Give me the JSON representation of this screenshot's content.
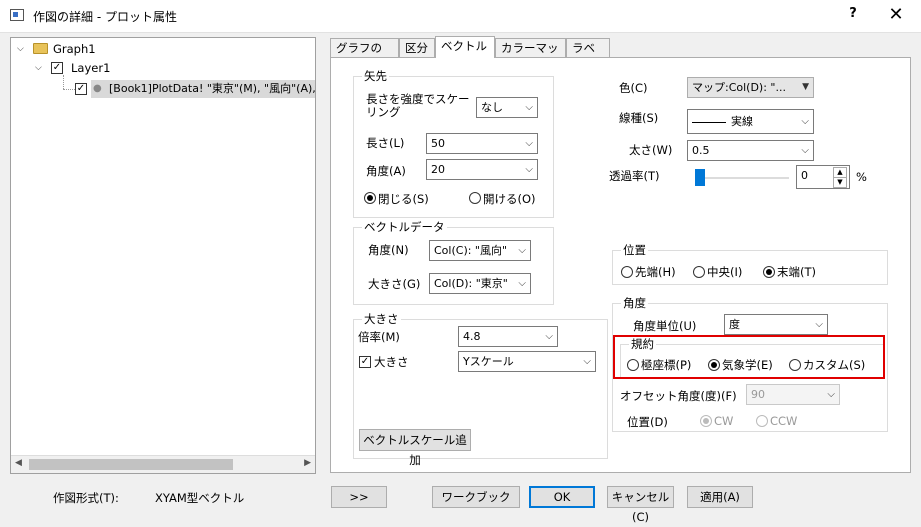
{
  "window": {
    "title": "作図の詳細 - プロット属性",
    "help": "?",
    "close": "✕"
  },
  "tree": {
    "graph": "Graph1",
    "layer": "Layer1",
    "plot": "[Book1]PlotData! \"東京\"(M), \"風向\"(A),"
  },
  "tabs": [
    "グラフの線",
    "区分",
    "ベクトル",
    "カラーマップ",
    "ラベル"
  ],
  "arrowhead": {
    "group": "矢先",
    "scale_label": "長さを強度でスケーリング",
    "scale_value": "なし",
    "length_label": "長さ(L)",
    "length_value": "50",
    "angle_label": "角度(A)",
    "angle_value": "20",
    "closed": "閉じる(S)",
    "open": "開ける(O)"
  },
  "vector_data": {
    "group": "ベクトルデータ",
    "angle_label": "角度(N)",
    "angle_value": "Col(C): \"風向\"",
    "mag_label": "大きさ(G)",
    "mag_value": "Col(D): \"東京\""
  },
  "magnitude": {
    "group": "大きさ",
    "ratio_label": "倍率(M)",
    "ratio_value": "4.8",
    "size_label": "大きさ",
    "size_value": "Yスケール",
    "add_button": "ベクトルスケール追加"
  },
  "style": {
    "color_label": "色(C)",
    "color_value": "マップ:Col(D): \"...",
    "line_label": "線種(S)",
    "line_value": "実線",
    "width_label": "太さ(W)",
    "width_value": "0.5",
    "transparency_label": "透過率(T)",
    "transparency_value": "0",
    "percent": "%",
    "transparency_level": 0
  },
  "position": {
    "group": "位置",
    "head": "先端(H)",
    "center": "中央(I)",
    "tail": "末端(T)"
  },
  "angle": {
    "group": "角度",
    "unit_label": "角度単位(U)",
    "unit_value": "度",
    "convention_group": "規約",
    "polar": "極座標(P)",
    "meteo": "気象学(E)",
    "custom": "カスタム(S)",
    "offset_label": "オフセット角度(度)(F)",
    "offset_value": "90",
    "pos_label": "位置(D)",
    "cw": "CW",
    "ccw": "CCW"
  },
  "footer": {
    "type_label": "作図形式(T):",
    "type_value": "XYAM型ベクトル",
    "toggle": ">>",
    "workbook": "ワークブック",
    "ok": "OK",
    "cancel": "キャンセル(C)",
    "apply": "適用(A)"
  }
}
